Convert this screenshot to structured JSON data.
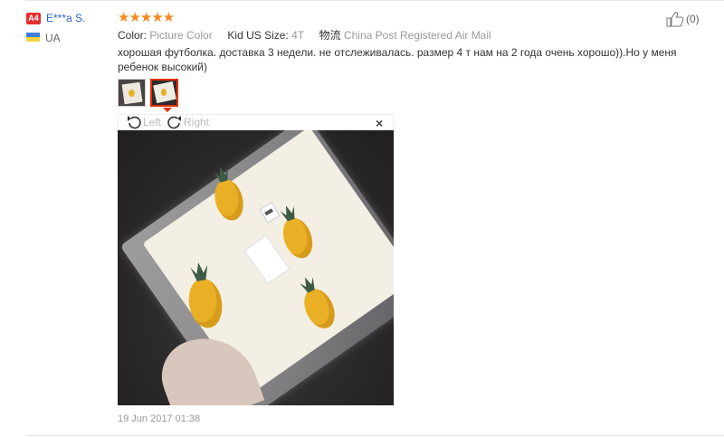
{
  "user": {
    "level_badge": "A4",
    "name": "E***a S.",
    "country": "UA",
    "flag_colors": {
      "top": "#3d7edb",
      "bottom": "#f4d23a"
    }
  },
  "review": {
    "rating": 5,
    "stars": "★★★★★",
    "star_color": "#f6891f",
    "attributes": [
      {
        "key": "Color:",
        "value": "Picture Color"
      },
      {
        "key": "Kid US Size:",
        "value": "4T"
      },
      {
        "key": "物流",
        "value": "China Post Registered Air Mail"
      }
    ],
    "text": "хорошая футболка. доставка 3 недели. не отслеживалась. размер 4 т нам на 2 года очень хорошо)).Но у меня ребенок высокий)",
    "helpful_count": "(0)",
    "date": "19 Jun 2017 01:38"
  },
  "viewer": {
    "rotate_left": "Left",
    "rotate_right": "Right",
    "close": "×",
    "active_thumb_index": 2,
    "active_color": "#e62e04"
  }
}
